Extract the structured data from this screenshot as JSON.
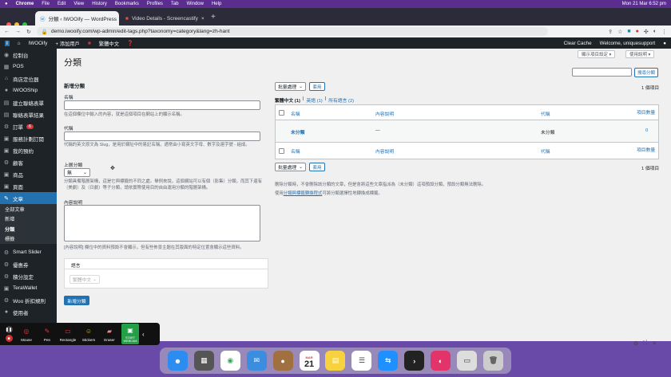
{
  "mac_menu": [
    "Chrome",
    "File",
    "Edit",
    "View",
    "History",
    "Bookmarks",
    "Profiles",
    "Tab",
    "Window",
    "Help"
  ],
  "mac_clock": "Mon 21 Mar 6:52 pm",
  "tabs": [
    {
      "title": "分類 ‹ IWOOify — WordPress",
      "active": true
    },
    {
      "title": "Video Details - Screencastify",
      "active": false
    }
  ],
  "new_tab": "+",
  "url": "demo.iwooify.com/wp-admin/edit-tags.php?taxonomy=category&lang=zh-hant",
  "admin_bar": {
    "site": "IWOOify",
    "new": "+ 添加用戶",
    "lang": "繁體中文",
    "clear_cache": "Clear Cache",
    "welcome": "Welcome, uniquesupport"
  },
  "sidebar": {
    "items": [
      {
        "icon": "dashboard-icon",
        "glyph": "◉",
        "label": "控制台"
      },
      {
        "icon": "pos-icon",
        "glyph": "▦",
        "label": "POS"
      },
      {
        "icon": "store-icon",
        "glyph": "⌂",
        "label": "商店定位器"
      },
      {
        "icon": "iwooship-icon",
        "glyph": "●",
        "label": "IWOOShip"
      },
      {
        "icon": "form-icon",
        "glyph": "▤",
        "label": "建立聯絡表單"
      },
      {
        "icon": "results-icon",
        "glyph": "▤",
        "label": "聯絡表單結果"
      },
      {
        "icon": "orders-icon",
        "glyph": "⚙",
        "label": "訂單",
        "badge": "6"
      },
      {
        "icon": "booking-icon",
        "glyph": "▣",
        "label": "服務計劃訂閱"
      },
      {
        "icon": "bookings-icon",
        "glyph": "▣",
        "label": "我的預約"
      },
      {
        "icon": "customers-icon",
        "glyph": "⚙",
        "label": "顧客"
      },
      {
        "icon": "products-icon",
        "glyph": "▣",
        "label": "商品"
      },
      {
        "icon": "pages-icon",
        "glyph": "▣",
        "label": "頁面"
      },
      {
        "icon": "posts-icon",
        "glyph": "✎",
        "label": "文章",
        "active": true
      }
    ],
    "submenu": [
      {
        "label": "全部文章"
      },
      {
        "label": "新增"
      },
      {
        "label": "分類",
        "current": true
      },
      {
        "label": "標籤"
      }
    ],
    "items2": [
      {
        "icon": "slider-icon",
        "glyph": "⚙",
        "label": "Smart Slider"
      },
      {
        "icon": "coupon-icon",
        "glyph": "⚙",
        "label": "優惠券"
      },
      {
        "icon": "points-icon",
        "glyph": "⚙",
        "label": "積分設定"
      },
      {
        "icon": "wallet-icon",
        "glyph": "▣",
        "label": "TeraWallet"
      },
      {
        "icon": "discount-icon",
        "glyph": "⚙",
        "label": "Woo 折扣規則"
      },
      {
        "icon": "users-icon",
        "glyph": "●",
        "label": "使用者"
      }
    ]
  },
  "page": {
    "title": "分類",
    "screen_options": "顯示項目設定 ▾",
    "help": "使用說明 ▾",
    "search_button": "搜尋分類",
    "search_placeholder": ""
  },
  "form": {
    "heading": "新增分類",
    "name_label": "名稱",
    "name_help": "在這個欄位中輸入的內容，就是這個項目在網站上的顯示名稱。",
    "slug_label": "代稱",
    "slug_help": "代稱的英文原文為 Slug，是用於網址中的易記名稱，通常由小寫英文字母、數字及連字號 - 組成。",
    "parent_label": "上層分類",
    "parent_value": "無",
    "parent_help": "分類具備階層架構，這是它與標籤的不同之處。舉例來說，這個網站可以有個〔影集〕分類，而其下還有〔美劇〕及〔日劇〕等子分類，請依實際使用目的自由運用分類的階層架構。",
    "desc_label": "內容說明",
    "desc_help": "[內容說明] 欄位中的資料預設不會顯示，但有些佈景主題在其版面的特定位置會顯示這些資料。",
    "lang_label": "語言",
    "lang_value": "繁體中文",
    "submit": "新增分類"
  },
  "list": {
    "bulk_label": "批量處理",
    "apply": "套用",
    "count": "1 個項目",
    "filters": [
      {
        "label": "繁體中文 (1)",
        "current": true
      },
      {
        "label": "英語 (1)"
      },
      {
        "label": "所有語言 (2)"
      }
    ],
    "columns": [
      "名稱",
      "內容說明",
      "代稱",
      "項目數量"
    ],
    "rows": [
      {
        "name": "未分類",
        "desc": "—",
        "slug": "未分類",
        "count": "0"
      }
    ],
    "note1": "刪除分類時，不會刪除該分類的文章，但是會將這些文章指派為（未分類）這項預設分類，預設分類無法刪除。",
    "note2_pre": "使用",
    "note2_link": "分類與標籤轉換程式",
    "note2_post": "可將分類選擇性地轉換成標籤。"
  },
  "screencastify": {
    "tools": [
      "Mouse",
      "Pen",
      "Rectangle",
      "Stickers",
      "Eraser",
      "START WEBCAM"
    ]
  },
  "dock": {
    "calendar_month": "MAR",
    "calendar_day": "21"
  }
}
